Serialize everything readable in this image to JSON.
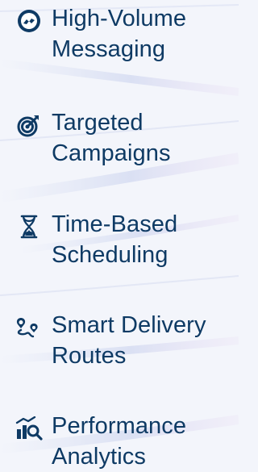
{
  "features": [
    {
      "label": "High-Volume Messaging",
      "icon": "messenger-icon"
    },
    {
      "label": "Targeted Campaigns",
      "icon": "target-icon"
    },
    {
      "label": "Time-Based Scheduling",
      "icon": "hourglass-icon"
    },
    {
      "label": "Smart Delivery Routes",
      "icon": "route-icon"
    },
    {
      "label": "Performance Analytics",
      "icon": "analytics-icon"
    }
  ],
  "colors": {
    "text": "#0e3a64",
    "icon": "#0e3a64",
    "background": "#f3f5fb"
  }
}
